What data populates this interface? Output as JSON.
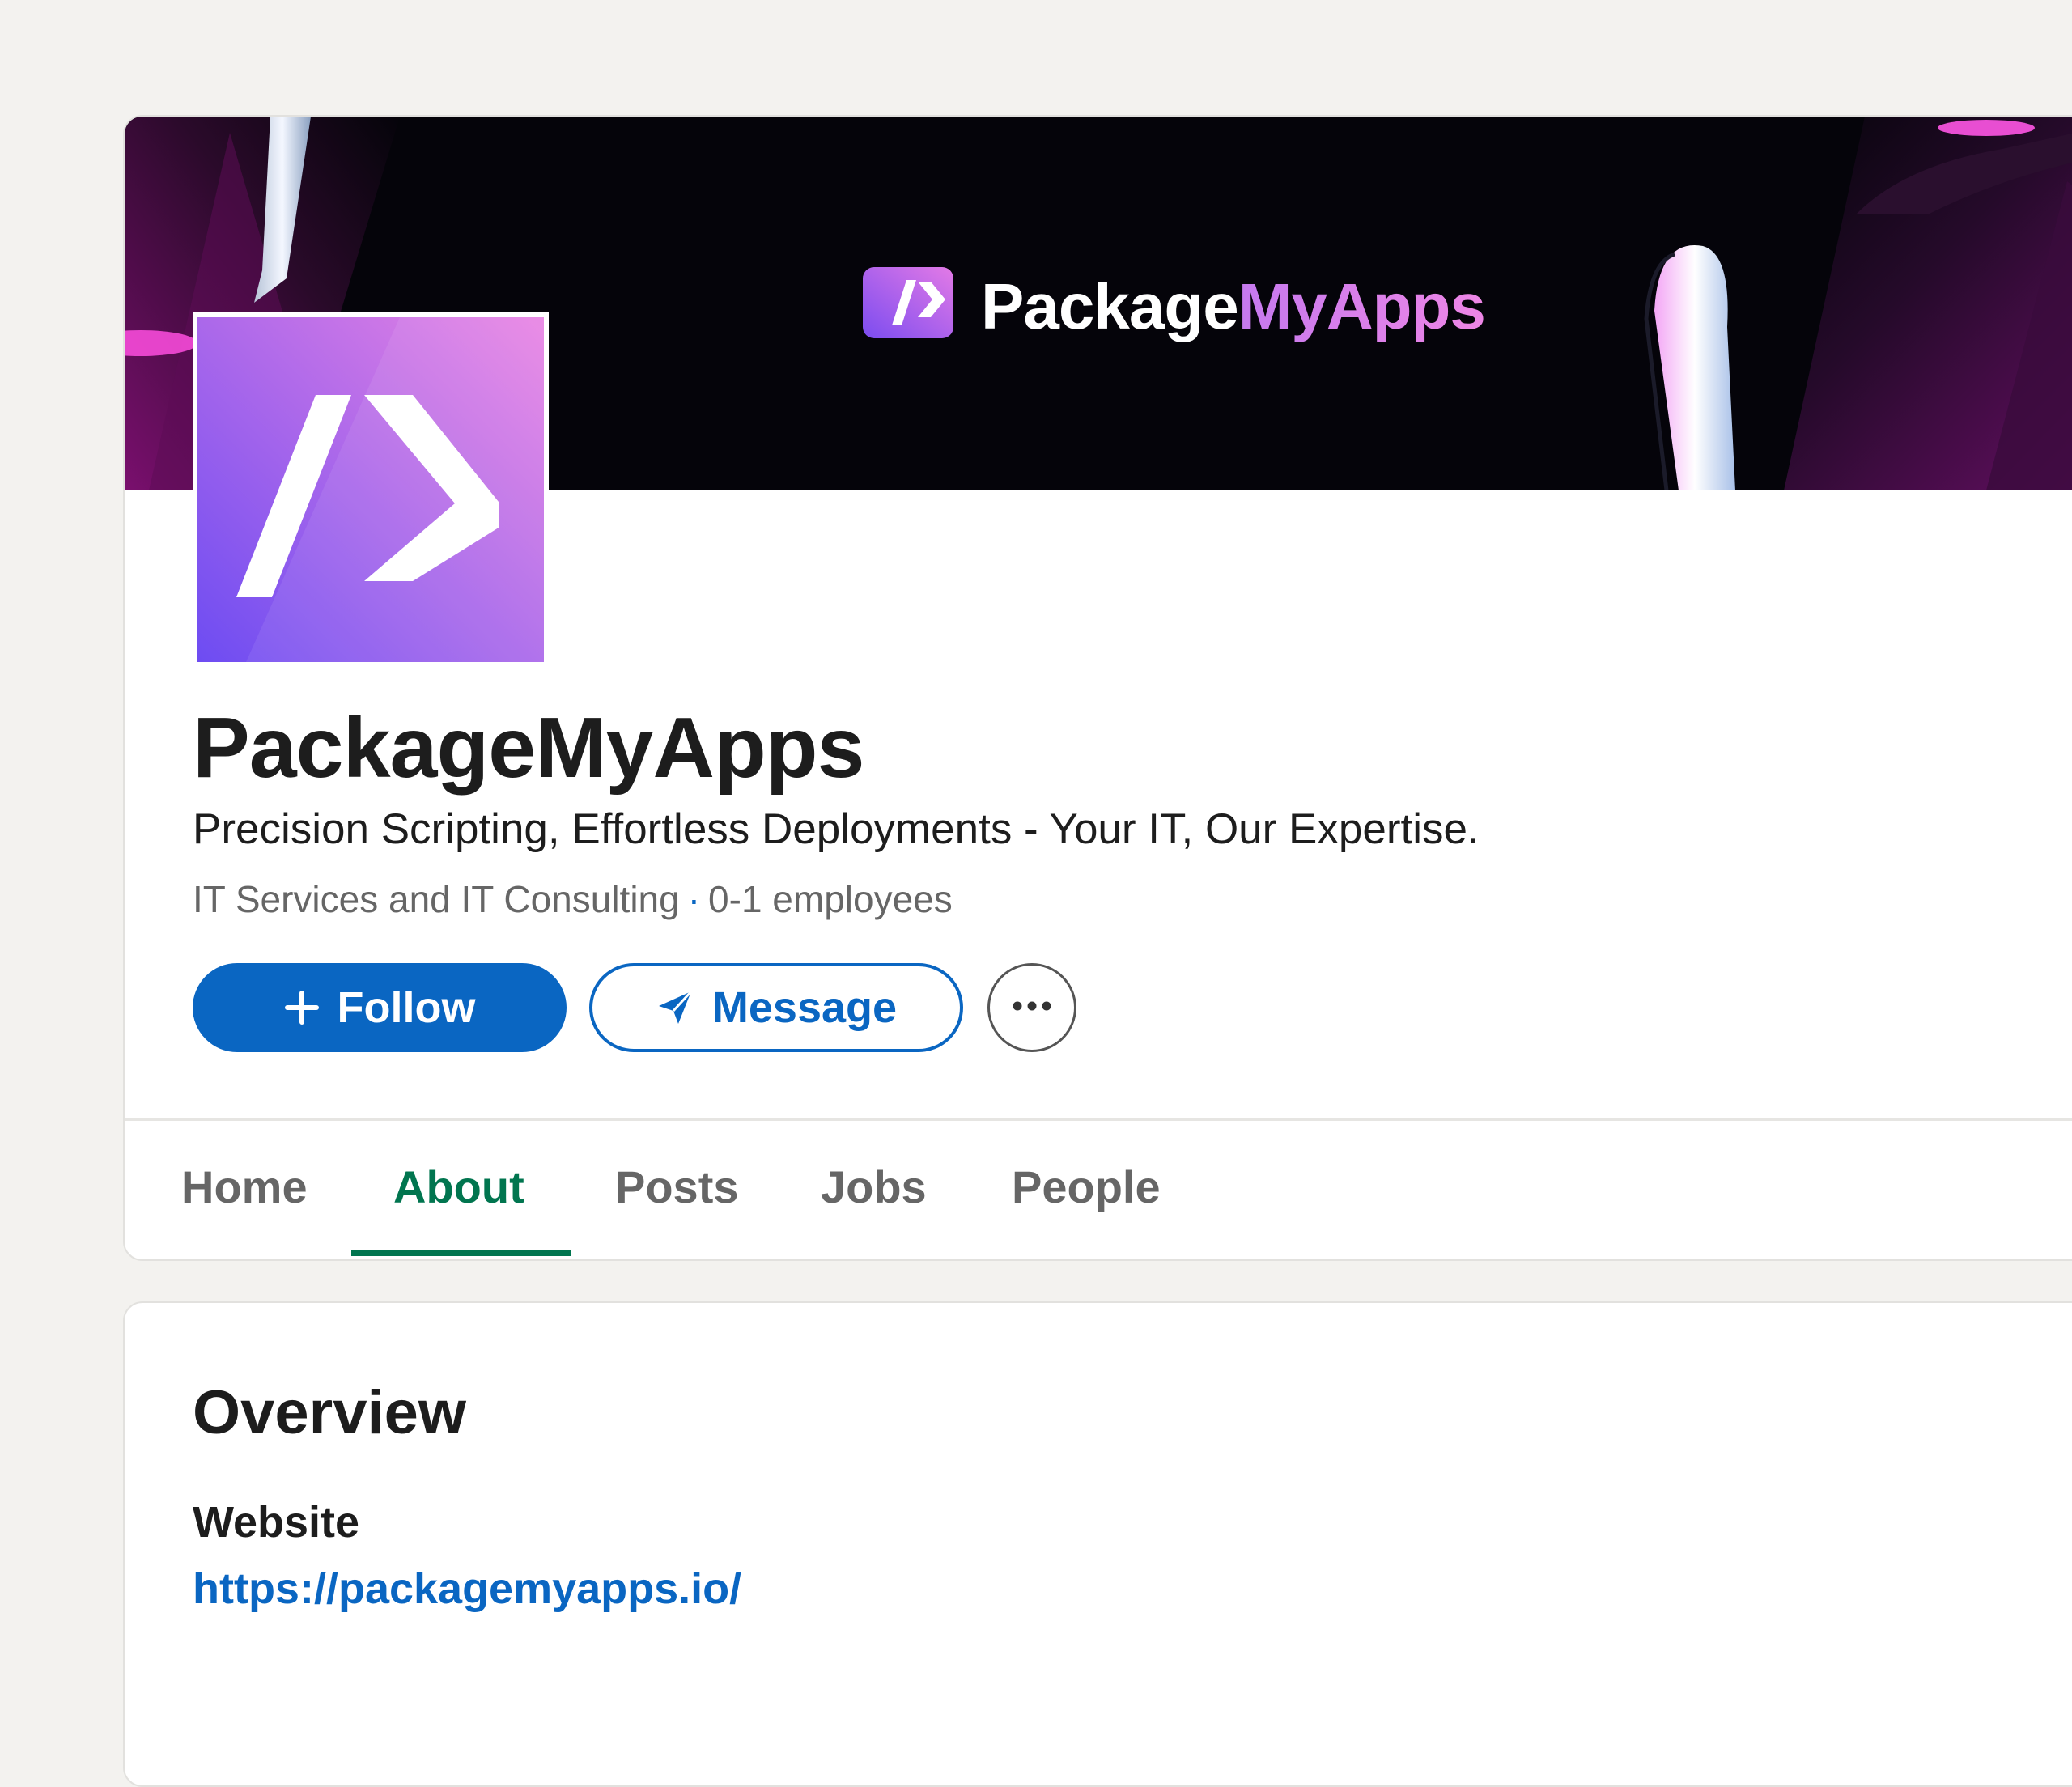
{
  "banner": {
    "brand_first": "Package",
    "brand_second": "MyApps",
    "colors": {
      "background": "#05040a",
      "accent_purple": "#8b5cf6",
      "accent_pink": "#e879f9"
    }
  },
  "company": {
    "name": "PackageMyApps",
    "tagline": "Precision Scripting, Effortless Deployments - Your IT, Our Expertise.",
    "industry": "IT Services and IT Consulting",
    "separator": "·",
    "size": "0-1 employees"
  },
  "actions": {
    "follow_icon": "plus-icon",
    "follow_label": "Follow",
    "message_icon": "send-icon",
    "message_label": "Message",
    "more_icon": "ellipsis-icon"
  },
  "tabs": [
    {
      "label": "Home",
      "active": false
    },
    {
      "label": "About",
      "active": true
    },
    {
      "label": "Posts",
      "active": false
    },
    {
      "label": "Jobs",
      "active": false
    },
    {
      "label": "People",
      "active": false
    }
  ],
  "overview": {
    "title": "Overview",
    "website_label": "Website",
    "website_url": "https://packagemyapps.io/"
  },
  "colors": {
    "primary_blue": "#0a66c2",
    "active_tab_green": "#01754f",
    "page_background": "#f3f2ef"
  }
}
